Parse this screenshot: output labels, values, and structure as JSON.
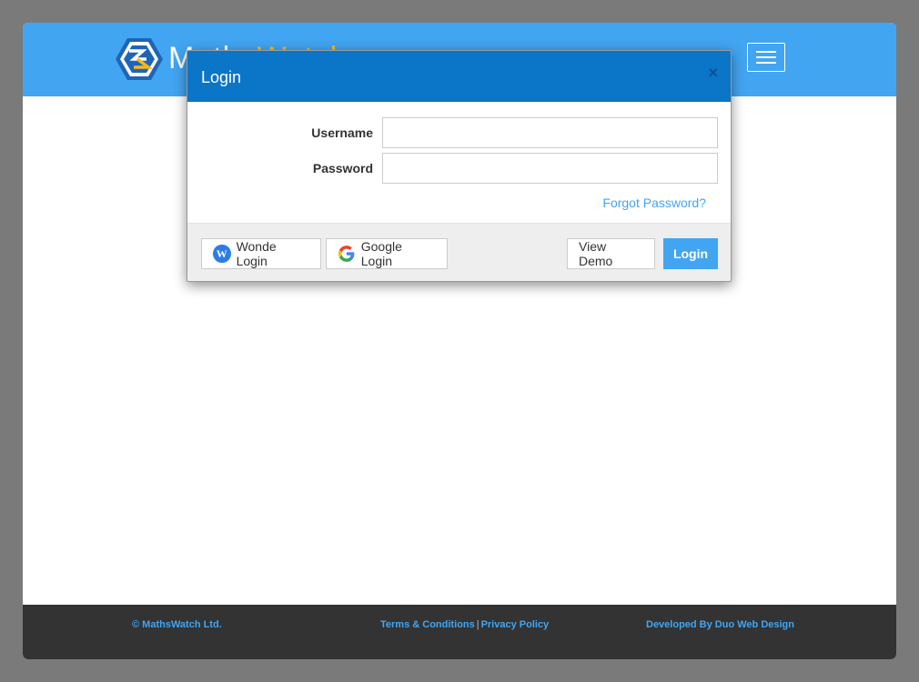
{
  "navbar": {
    "brand_primary": "Maths",
    "brand_accent": "Watch"
  },
  "modal": {
    "title": "Login",
    "close_glyph": "×",
    "username_label": "Username",
    "username_value": "",
    "password_label": "Password",
    "password_value": "",
    "forgot_link": "Forgot Password?",
    "wonde_button": "Wonde Login",
    "wonde_icon_letter": "W",
    "google_button": "Google Login",
    "demo_button": "View Demo",
    "login_button": "Login"
  },
  "footer": {
    "copyright": "© MathsWatch Ltd.",
    "terms_link": "Terms & Conditions",
    "separator": "|",
    "privacy_link": "Privacy Policy",
    "developer_link": "Developed By Duo Web Design"
  },
  "colors": {
    "navbar": "#42a5f1",
    "modal_header": "#0b75c8",
    "accent": "#f5b81c",
    "footer": "#333333"
  }
}
